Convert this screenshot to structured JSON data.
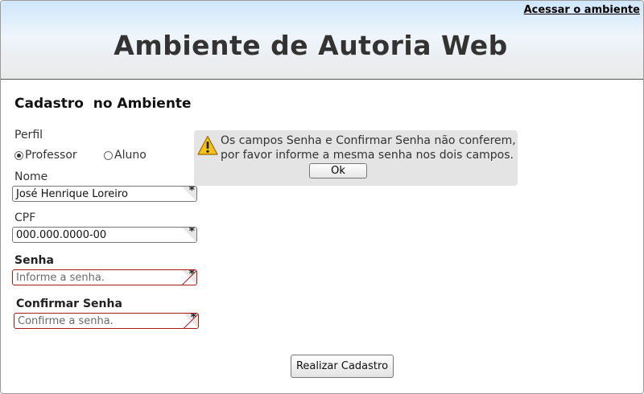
{
  "header": {
    "access_link": "Acessar o ambiente",
    "title": "Ambiente de Autoria Web"
  },
  "form": {
    "heading": "Cadastro  no Ambiente",
    "perfil_label": "Perfil",
    "perfil_options": [
      "Professor",
      "Aluno"
    ],
    "perfil_selected": "Professor",
    "nome_label": "Nome",
    "nome_value": "José Henrique Loreiro",
    "cpf_label": "CPF",
    "cpf_value": "000.000.0000-00",
    "senha_label": "Senha",
    "senha_placeholder": "Informe a senha.",
    "confirmar_label": "Confirmar Senha",
    "confirmar_placeholder": "Confirme a senha.",
    "required_mark": "*",
    "submit_label": "Realizar Cadastro"
  },
  "dialog": {
    "icon": "warning-icon",
    "message_line1": "Os campos Senha e Confirmar Senha não conferem,",
    "message_line2": "por favor informe a mesma senha nos dois campos.",
    "ok_label": "Ok"
  },
  "colors": {
    "error_border": "#a61a1a",
    "dialog_bg": "#e4e4e4",
    "header_gradient_top": "#cfe6fb"
  }
}
